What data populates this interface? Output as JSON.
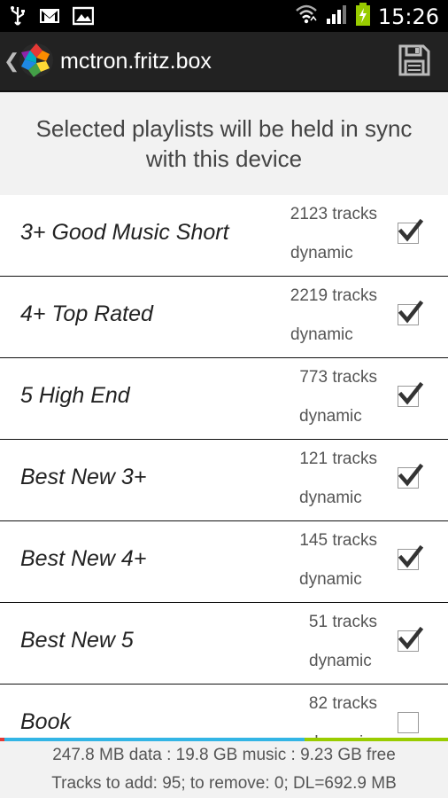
{
  "status_bar": {
    "left_icons": [
      "usb-icon",
      "gmail-icon",
      "gallery-icon"
    ],
    "right_icons": [
      "wifi-icon",
      "signal-icon",
      "battery-charging-icon"
    ],
    "time": "15:26"
  },
  "action_bar": {
    "title": "mctron.fritz.box",
    "save_icon": "save-icon"
  },
  "prompt": "Selected playlists will be held in sync with this device",
  "playlists": [
    {
      "name": "3+ Good Music Short",
      "tracks": "2123 tracks",
      "type": "dynamic",
      "checked": true
    },
    {
      "name": "4+ Top Rated",
      "tracks": "2219 tracks",
      "type": "dynamic",
      "checked": true
    },
    {
      "name": "5 High End",
      "tracks": "773 tracks",
      "type": "dynamic",
      "checked": true
    },
    {
      "name": "Best New 3+",
      "tracks": "121 tracks",
      "type": "dynamic",
      "checked": true
    },
    {
      "name": "Best New 4+",
      "tracks": "145 tracks",
      "type": "dynamic",
      "checked": true
    },
    {
      "name": "Best New 5",
      "tracks": "51 tracks",
      "type": "dynamic",
      "checked": true
    },
    {
      "name": "Book",
      "tracks": "82 tracks",
      "type": "dynamic",
      "checked": false
    }
  ],
  "storage_bar": {
    "segments": [
      {
        "color": "#e53935",
        "fraction": 0.01
      },
      {
        "color": "#33b5e5",
        "fraction": 0.67
      },
      {
        "color": "#99cc00",
        "fraction": 0.32
      }
    ]
  },
  "footer": {
    "line1": "247.8 MB data : 19.8 GB music : 9.23 GB free",
    "line2": "Tracks to add: 95; to remove: 0; DL=692.9 MB"
  }
}
